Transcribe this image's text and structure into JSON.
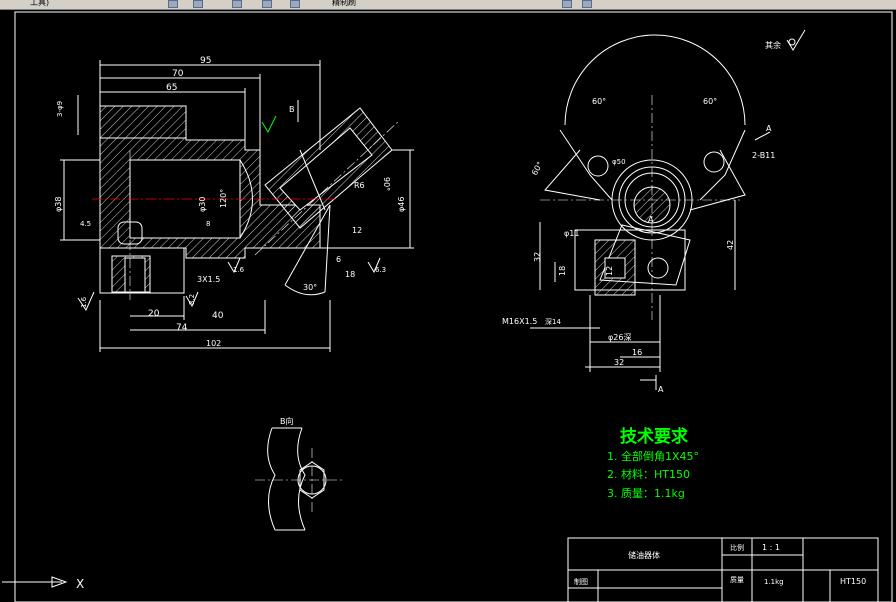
{
  "toolbar": {
    "left_text": "工具)",
    "right_text": "精制刷"
  },
  "drawing": {
    "roughness_note": "其余",
    "section_b_label": "B向",
    "view_a_label": "A",
    "arrow_b_label": "B",
    "dims_front": {
      "d95": "95",
      "d70": "70",
      "d65": "65",
      "d3phi9": "3-φ9",
      "d38": "φ38",
      "d30": "φ30",
      "d120": "120°",
      "d3x15": "3X1.5",
      "d20": "20",
      "d40": "40",
      "d74": "74",
      "d102": "102",
      "d30deg": "30°",
      "d16": "1.6",
      "d32": "3.2",
      "d63": "6.3",
      "dR6": "R6",
      "d90": "90°",
      "d46": "φ46",
      "d12": "12",
      "d18": "18",
      "d6": "6",
      "d45": "4.5",
      "d8": "8"
    },
    "dims_side": {
      "a60a": "60°",
      "a60b": "60°",
      "a60c": "60°",
      "d2b11": "2-B11",
      "d11": "φ11",
      "d32": "32",
      "d18": "18",
      "d12": "12",
      "d42": "42",
      "thread": "M16X1.5",
      "thread_depth": "深14",
      "d26": "φ26深",
      "d16": "16",
      "d32b": "32",
      "d50": "φ50",
      "label_a": "A"
    }
  },
  "tech_req": {
    "title": "技术要求",
    "items": [
      "1. 全部倒角1X45°",
      "2. 材料：HT150",
      "3. 质量：1.1kg"
    ]
  },
  "title_block": {
    "part_name": "储油器体",
    "scale_label": "比例",
    "scale_value": "1 : 1",
    "mass_label": "质量",
    "mass_value": "1.1kg",
    "material": "HT150",
    "drawn_label": "制图"
  },
  "ucs": {
    "x_label": "X"
  },
  "colors": {
    "background": "#000000",
    "line": "#ffffff",
    "text_green": "#00ff00",
    "dim_line": "#ffffff",
    "center_line": "#ff0000"
  }
}
